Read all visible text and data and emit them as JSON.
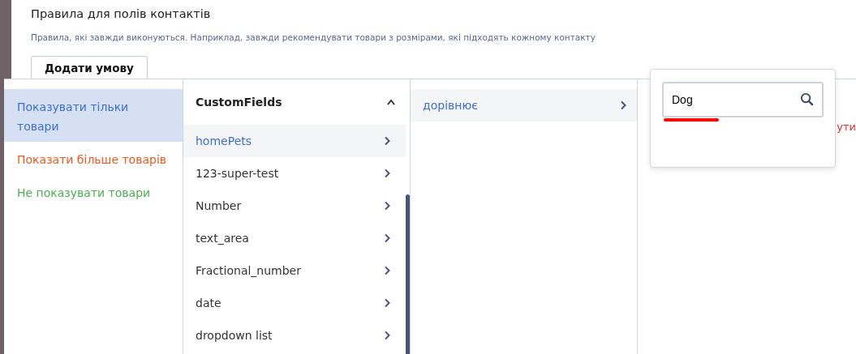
{
  "rules": {
    "title": "Правила для полів контактів",
    "description": "Правила, які завжди виконуються. Наприклад, завжди рекомендувати товари з розмірами, які підходять кожному контакту",
    "add_button": "Додати умову",
    "error_fragment": "ути"
  },
  "dropdown": {
    "actions": [
      {
        "label": "Показувати тільки товари",
        "color": "#3d6fd4",
        "selected": true
      },
      {
        "label": "Показати більше товарів",
        "color": "#ee5a1e",
        "selected": false
      },
      {
        "label": "Не показувати товари",
        "color": "#4caf50",
        "selected": false
      }
    ],
    "fields": {
      "group": "CustomFields",
      "expanded": true,
      "items": [
        {
          "label": "homePets",
          "selected": true
        },
        {
          "label": "123-super-test",
          "selected": false
        },
        {
          "label": "Number",
          "selected": false
        },
        {
          "label": "text_area",
          "selected": false
        },
        {
          "label": "Fractional_number",
          "selected": false
        },
        {
          "label": "date",
          "selected": false
        },
        {
          "label": "dropdown list",
          "selected": false
        }
      ]
    },
    "operators": [
      {
        "label": "дорівнює",
        "selected": true
      }
    ]
  },
  "value_popover": {
    "value": "Dog",
    "spell_error": true
  }
}
